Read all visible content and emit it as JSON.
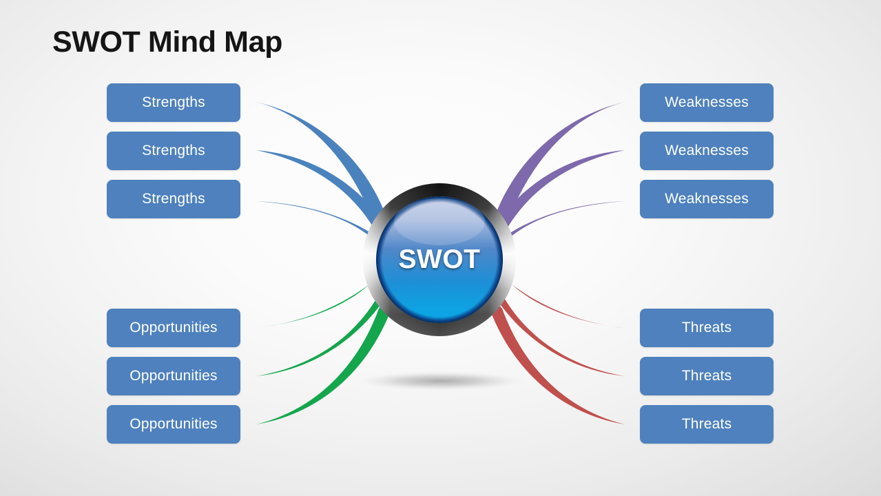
{
  "page": {
    "title": "SWOT Mind Map",
    "background_start": "#fdfdfd",
    "background_end": "#dcdcdc"
  },
  "center": {
    "label": "SWOT",
    "orb_color_top": "#b9c6e2",
    "orb_color_bottom": "#0d9fe0",
    "ring_color_dark": "#1b1b1b",
    "ring_color_light": "#f2f2f2"
  },
  "branches": [
    {
      "id": "strengths",
      "label": "Strengths",
      "color": "#4a82bd",
      "side": "left",
      "quadrant": "top-left",
      "count": 3
    },
    {
      "id": "weaknesses",
      "label": "Weaknesses",
      "color": "#7d69ab",
      "side": "right",
      "quadrant": "top-right",
      "count": 3
    },
    {
      "id": "opportunities",
      "label": "Opportunities",
      "color": "#14a64d",
      "side": "left",
      "quadrant": "bottom-left",
      "count": 3
    },
    {
      "id": "threats",
      "label": "Threats",
      "color": "#c0504d",
      "side": "right",
      "quadrant": "bottom-right",
      "count": 3
    }
  ],
  "nodes": {
    "top_left": [
      "Strengths",
      "Strengths",
      "Strengths"
    ],
    "top_right": [
      "Weaknesses",
      "Weaknesses",
      "Weaknesses"
    ],
    "bottom_left": [
      "Opportunities",
      "Opportunities",
      "Opportunities"
    ],
    "bottom_right": [
      "Threats",
      "Threats",
      "Threats"
    ]
  },
  "box_style": {
    "fill": "#4e81bd",
    "text_color": "#ffffff"
  }
}
